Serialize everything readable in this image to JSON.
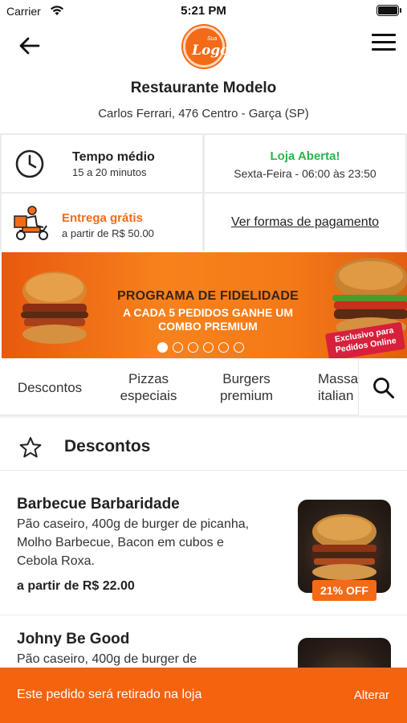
{
  "status_bar": {
    "carrier": "Carrier",
    "time": "5:21 PM"
  },
  "header": {
    "logo_small": "Sua",
    "logo_main": "Logo"
  },
  "restaurant": {
    "name": "Restaurante Modelo",
    "address": "Carlos Ferrari, 476  Centro - Garça (SP)"
  },
  "info": {
    "avg_time_title": "Tempo médio",
    "avg_time_value": "15 a 20 minutos",
    "open_status": "Loja Aberta!",
    "open_hours": "Sexta-Feira - 06:00 às 23:50",
    "delivery_title": "Entrega grátis",
    "delivery_sub": "a partir de R$ 50.00",
    "payment_link": "Ver formas de pagamento"
  },
  "banner": {
    "title": "PROGRAMA DE FIDELIDADE",
    "line1": "A CADA 5 PEDIDOS GANHE UM",
    "line2": "COMBO PREMIUM",
    "tag_line1": "Exclusivo para",
    "tag_line2": "Pedidos Online",
    "slides_count": 6,
    "active_slide": 1
  },
  "categories": [
    {
      "line1": "Descontos",
      "line2": ""
    },
    {
      "line1": "Pizzas",
      "line2": "especiais"
    },
    {
      "line1": "Burgers",
      "line2": "premium"
    },
    {
      "line1": "Massa",
      "line2": "italian"
    }
  ],
  "section": {
    "title": "Descontos"
  },
  "products": [
    {
      "name": "Barbecue Barbaridade",
      "description": "Pão caseiro, 400g de burger de picanha, Molho Barbecue, Bacon em cubos e Cebola Roxa.",
      "price_prefix": "a partir de",
      "price": "R$ 22.00",
      "discount": "21% OFF"
    },
    {
      "name": "Johny Be Good",
      "description": "Pão caseiro, 400g de burger de"
    }
  ],
  "footer": {
    "message": "Este pedido será retirado na loja",
    "action": "Alterar"
  },
  "colors": {
    "accent": "#f36b17",
    "open": "#2db34a",
    "footer": "#f5630f"
  },
  "icons": [
    "wifi-icon",
    "battery-icon",
    "back-arrow-icon",
    "menu-icon",
    "clock-icon",
    "delivery-moto-icon",
    "search-icon",
    "star-icon"
  ]
}
